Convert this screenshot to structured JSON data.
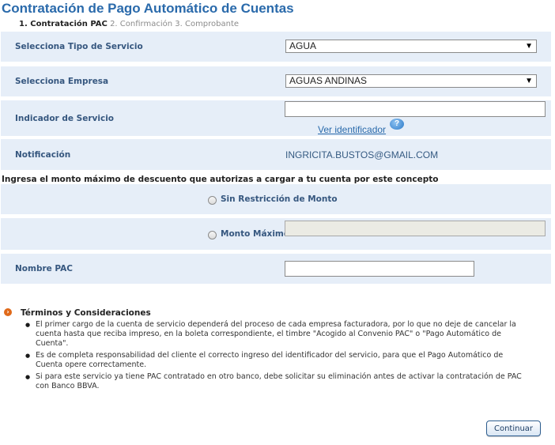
{
  "page": {
    "title": "Contratación de Pago Automático de Cuentas"
  },
  "steps": [
    {
      "label": "1. Contratación PAC",
      "state": "active"
    },
    {
      "label": "2. Confirmación",
      "state": "inactive"
    },
    {
      "label": "3. Comprobante",
      "state": "inactive"
    }
  ],
  "form": {
    "tipo_servicio": {
      "label": "Selecciona Tipo de Servicio",
      "value": "AGUA"
    },
    "empresa": {
      "label": "Selecciona Empresa",
      "value": "AGUAS ANDINAS"
    },
    "indicador": {
      "label": "Indicador de Servicio",
      "value": "",
      "link": "Ver identificador",
      "help_icon": "question-help-icon"
    },
    "notificacion": {
      "label": "Notificación",
      "value": "INGRICITA.BUSTOS@GMAIL.COM"
    },
    "instruction": "Ingresa el monto máximo de descuento que autorizas a cargar a tu cuenta por este concepto",
    "sin_restriccion": {
      "label": "Sin Restricción de Monto",
      "selected": false
    },
    "monto_maximo": {
      "label": "Monto Máximo",
      "selected": false,
      "value": ""
    },
    "nombre_pac": {
      "label": "Nombre PAC",
      "value": ""
    }
  },
  "terms": {
    "title": "Términos y Consideraciones",
    "items": [
      "El primer cargo de la cuenta de servicio dependerá del proceso de cada empresa facturadora, por lo que no deje de cancelar la cuenta hasta que reciba impreso, en la boleta correspondiente, el timbre \"Acogido al Convenio PAC\" o \"Pago Automático de Cuenta\".",
      "Es de completa responsabilidad del cliente el correcto ingreso del identificador del servicio, para que el Pago Automático de Cuenta opere correctamente.",
      "Si para este servicio ya tiene PAC contratado en otro banco, debe solicitar su eliminación antes de activar la contratación de PAC con Banco BBVA."
    ]
  },
  "actions": {
    "continue_label": "Continuar"
  },
  "colors": {
    "title": "#2a6aab",
    "row_bg": "#e6eef8",
    "label": "#36577f",
    "accent_bullet": "#e06a1a"
  }
}
